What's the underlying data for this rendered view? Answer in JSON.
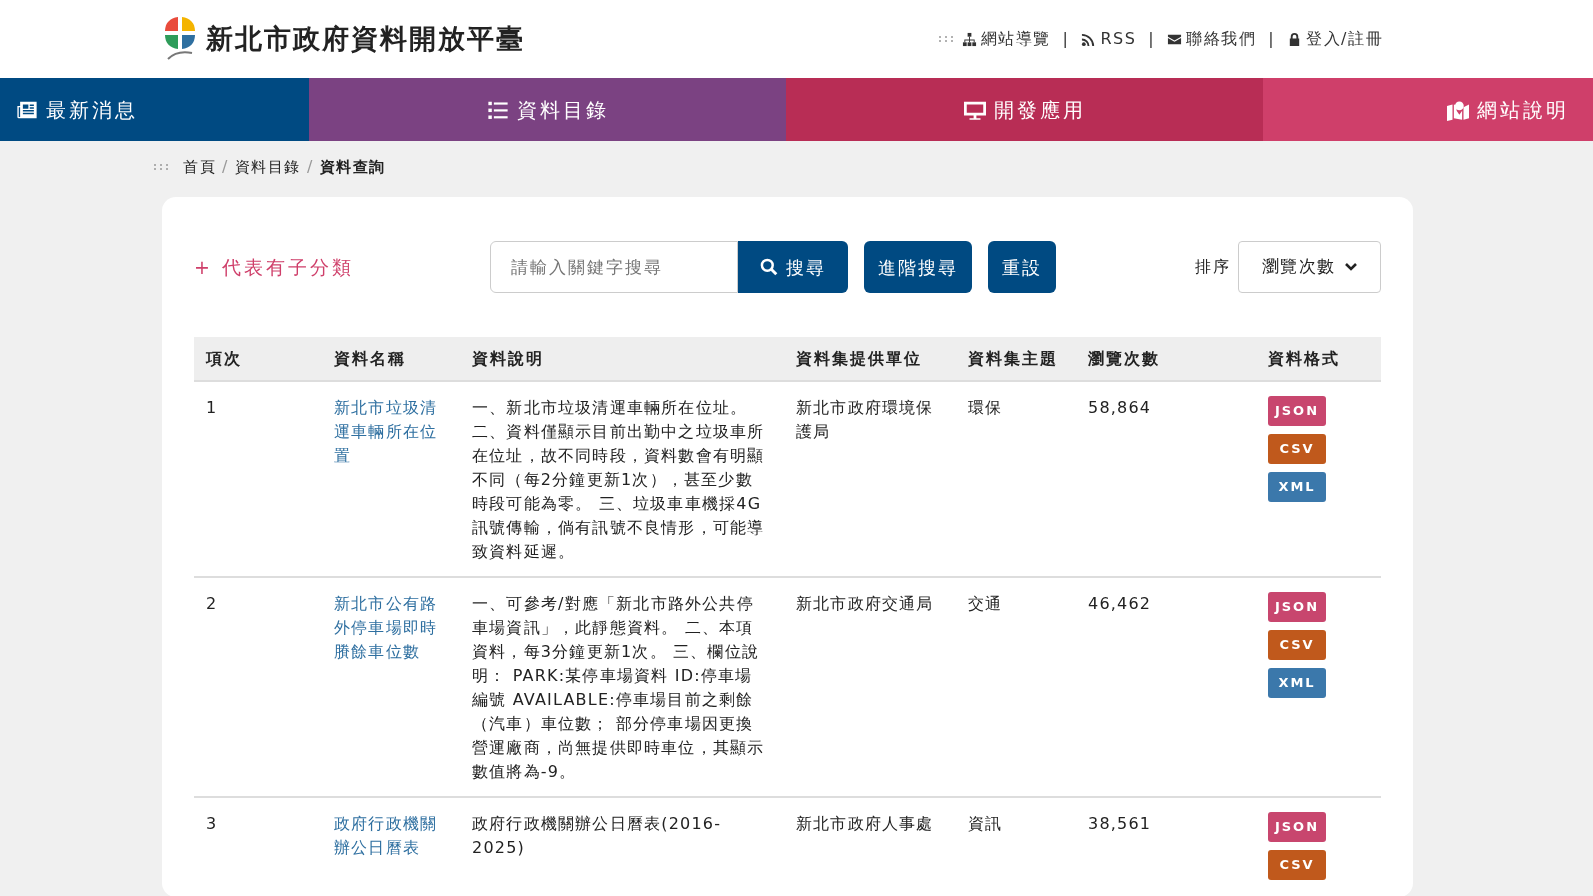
{
  "site_title": "新北市政府資料開放平臺",
  "top_links": [
    {
      "kind": "sitemap",
      "label": "網站導覽"
    },
    {
      "kind": "rss",
      "label": "RSS"
    },
    {
      "kind": "mail",
      "label": "聯絡我們"
    },
    {
      "kind": "lock",
      "label": "登入/註冊"
    }
  ],
  "top_link_separators": [
    "|",
    "|",
    "|"
  ],
  "nav": [
    {
      "kind": "news",
      "label": "最新消息"
    },
    {
      "kind": "list",
      "label": "資料目錄"
    },
    {
      "kind": "monitor",
      "label": "開發應用"
    },
    {
      "kind": "map",
      "label": "網站說明"
    }
  ],
  "breadcrumb": [
    "首頁",
    "資料目錄",
    "資料查詢"
  ],
  "breadcrumb_separators": [
    "/",
    "/"
  ],
  "legend": "+ 代表有子分類",
  "search": {
    "placeholder": "請輸入關鍵字搜尋",
    "button": "搜尋"
  },
  "buttons": [
    "進階搜尋",
    "重設"
  ],
  "sort": {
    "label": "排序",
    "value": "瀏覽次數"
  },
  "table": {
    "columns": [
      "項次",
      "資料名稱",
      "資料說明",
      "資料集提供單位",
      "資料集主題",
      "瀏覽次數",
      "資料格式"
    ],
    "rows": [
      {
        "index": "1",
        "name": "新北市垃圾清運車輛所在位置",
        "description": "一、新北市垃圾清運車輛所在位址。二、資料僅顯示目前出勤中之垃圾車所在位址，故不同時段，資料數會有明顯不同（每2分鐘更新1次），甚至少數時段可能為零。 三、垃圾車車機採4G訊號傳輸，倘有訊號不良情形，可能導致資料延遲。",
        "agency": "新北市政府環境保護局",
        "theme": "環保",
        "views": "58,864",
        "formats": [
          {
            "kind": "json",
            "label": "JSON"
          },
          {
            "kind": "csv",
            "label": "CSV"
          },
          {
            "kind": "xml",
            "label": "XML"
          }
        ]
      },
      {
        "index": "2",
        "name": "新北市公有路外停車場即時賸餘車位數",
        "description": "一、可參考/對應「新北市路外公共停車場資訊」，此靜態資料。 二、本項資料，每3分鐘更新1次。 三、欄位說明： PARK:某停車場資料 ID:停車場編號 AVAILABLE:停車場目前之剩餘（汽車）車位數； 部分停車場因更換營運廠商，尚無提供即時車位，其顯示數值將為-9。",
        "agency": "新北市政府交通局",
        "theme": "交通",
        "views": "46,462",
        "formats": [
          {
            "kind": "json",
            "label": "JSON"
          },
          {
            "kind": "csv",
            "label": "CSV"
          },
          {
            "kind": "xml",
            "label": "XML"
          }
        ]
      },
      {
        "index": "3",
        "name": "政府行政機關辦公日曆表",
        "description": "政府行政機關辦公日曆表(2016-2025)",
        "agency": "新北市政府人事處",
        "theme": "資訊",
        "views": "38,561",
        "formats": [
          {
            "kind": "json",
            "label": "JSON"
          },
          {
            "kind": "csv",
            "label": "CSV"
          }
        ]
      }
    ]
  }
}
